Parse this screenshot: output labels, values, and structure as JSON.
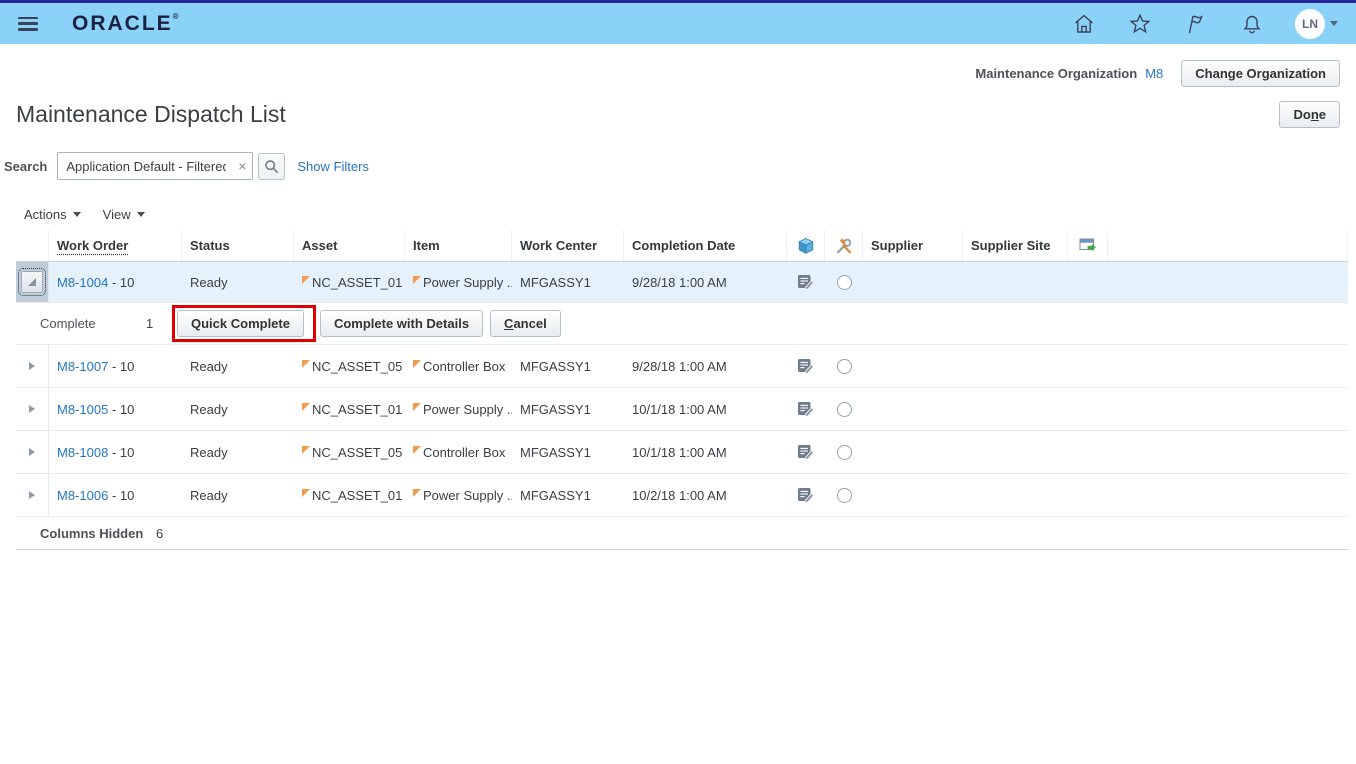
{
  "colors": {
    "topbar_bg": "#8bd2f8",
    "topbar_accent": "#26269a",
    "link_blue": "#2576c2",
    "selected_row_bg": "#e5f2fc",
    "annotation_red": "#e10000",
    "flag_orange": "#f29b4e"
  },
  "icons": {
    "topbar": [
      "menu",
      "home",
      "favorites",
      "flag",
      "notifications",
      "chevron-down"
    ],
    "table_header": [
      "asset-cube",
      "maintenance-tools",
      "detach-window"
    ],
    "row": [
      "note-edit",
      "radio"
    ]
  },
  "topbar": {
    "brand": "ORACLE",
    "brand_mark": "®",
    "avatar": "LN"
  },
  "context": {
    "label": "Maintenance Organization",
    "value": "M8",
    "change_button": "Change Organization"
  },
  "page": {
    "title": "Maintenance Dispatch List",
    "done": {
      "pre": "Do",
      "key": "n",
      "post": "e"
    }
  },
  "search": {
    "label": "Search",
    "value": "Application Default - Filtered",
    "clear": "×",
    "show_filters": "Show Filters"
  },
  "menus": {
    "actions": "Actions",
    "view": "View"
  },
  "table": {
    "headers": {
      "work_order": "Work Order",
      "status": "Status",
      "asset": "Asset",
      "item": "Item",
      "work_center": "Work Center",
      "completion_date": "Completion Date",
      "supplier": "Supplier",
      "supplier_site": "Supplier Site"
    },
    "rows": [
      {
        "work_order": "M8-1004",
        "suffix": "- 10",
        "status": "Ready",
        "asset": "NC_ASSET_01",
        "item": "Power Supply ...",
        "work_center": "MFGASSY1",
        "completion_date": "9/28/18 1:00 AM"
      },
      {
        "work_order": "M8-1007",
        "suffix": "- 10",
        "status": "Ready",
        "asset": "NC_ASSET_05",
        "item": "Controller Box",
        "work_center": "MFGASSY1",
        "completion_date": "9/28/18 1:00 AM"
      },
      {
        "work_order": "M8-1005",
        "suffix": "- 10",
        "status": "Ready",
        "asset": "NC_ASSET_01",
        "item": "Power Supply ...",
        "work_center": "MFGASSY1",
        "completion_date": "10/1/18 1:00 AM"
      },
      {
        "work_order": "M8-1008",
        "suffix": "- 10",
        "status": "Ready",
        "asset": "NC_ASSET_05",
        "item": "Controller Box",
        "work_center": "MFGASSY1",
        "completion_date": "10/1/18 1:00 AM"
      },
      {
        "work_order": "M8-1006",
        "suffix": "- 10",
        "status": "Ready",
        "asset": "NC_ASSET_01",
        "item": "Power Supply ...",
        "work_center": "MFGASSY1",
        "completion_date": "10/2/18 1:00 AM"
      }
    ],
    "footer": {
      "label": "Columns Hidden",
      "value": "6"
    }
  },
  "complete_panel": {
    "label": "Complete",
    "quantity": "1",
    "quick_complete": "Quick Complete",
    "complete_with_details": "Complete with Details",
    "cancel": {
      "key": "C",
      "post": "ancel"
    }
  }
}
